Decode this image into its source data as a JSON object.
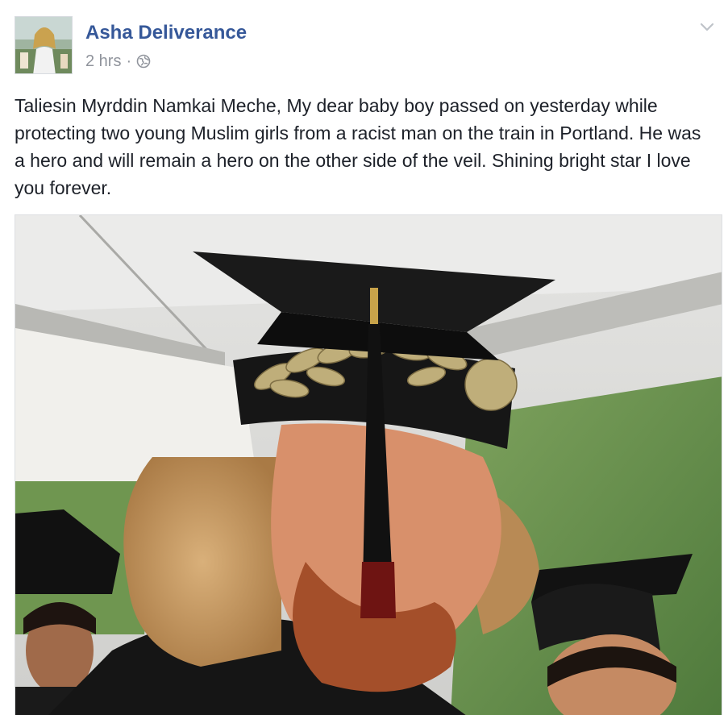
{
  "post": {
    "author": "Asha Deliverance",
    "timestamp": "2 hrs",
    "separator": "·",
    "privacy_icon": "globe-icon",
    "menu_icon": "chevron-down-icon",
    "text": "Taliesin Myrddin Namkai Meche, My dear baby boy passed on yesterday while protecting two young Muslim girls from a racist man on the train in Portland. He was a hero and will remain a hero on the other side of the veil. Shining bright star I love you forever."
  },
  "colors": {
    "author_link": "#365899",
    "meta_text": "#90949c",
    "body_text": "#1d2129"
  }
}
